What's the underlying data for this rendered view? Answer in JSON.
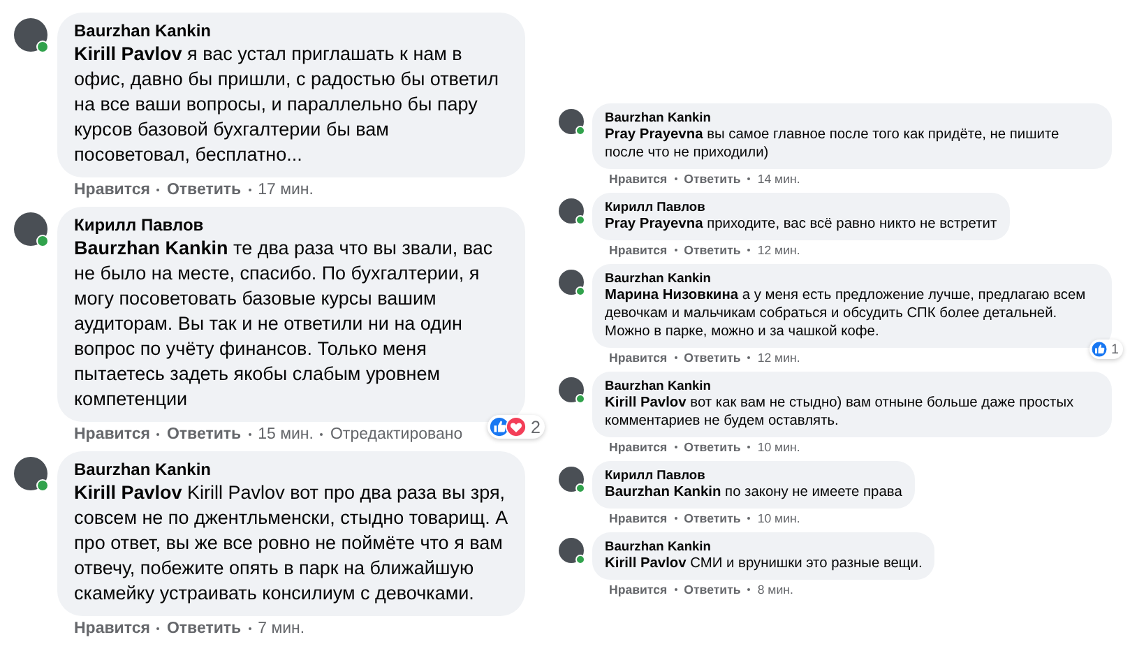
{
  "columns": [
    {
      "kind": "large",
      "comments": [
        {
          "author": "Baurzhan Kankin",
          "online": true,
          "text": "**Kirill Pavlov** я вас устал приглашать к нам в офис, давно бы пришли, с радостью бы ответил на все ваши вопросы, и параллельно бы пару курсов базовой бухгалтерии бы вам посоветовал, бесплатно...",
          "actions": [
            {
              "kind": "link",
              "text": "Нравится"
            },
            {
              "kind": "link",
              "text": "Ответить"
            },
            {
              "kind": "time",
              "text": "17 мин."
            }
          ]
        },
        {
          "author": "Кирилл Павлов",
          "online": true,
          "text": "**Baurzhan Kankin** те два раза что вы звали, вас не было на месте, спасибо. По бухгалтерии, я могу посоветовать базовые курсы вашим аудиторам. Вы так и не ответили ни на один вопрос по учёту финансов. Только меня пытаетесь задеть якобы слабым уровнем компетенции",
          "actions": [
            {
              "kind": "link",
              "text": "Нравится"
            },
            {
              "kind": "link",
              "text": "Ответить"
            },
            {
              "kind": "time",
              "text": "15 мин."
            },
            {
              "kind": "note",
              "text": "Отредактировано"
            }
          ],
          "reactions": {
            "items": [
              {
                "kind": "like"
              },
              {
                "kind": "love"
              }
            ],
            "count": "2"
          }
        },
        {
          "author": "Baurzhan Kankin",
          "online": true,
          "text": "**Kirill Pavlov** Kirill Pavlov вот про два раза вы зря, совсем не по джентльменски, стыдно товарищ. А про ответ, вы же все ровно не поймёте что я вам отвечу, побежите опять в парк на ближайшую скамейку устраивать консилиум с девочками.",
          "actions": [
            {
              "kind": "link",
              "text": "Нравится"
            },
            {
              "kind": "link",
              "text": "Ответить"
            },
            {
              "kind": "time",
              "text": "7 мин."
            }
          ]
        }
      ]
    },
    {
      "kind": "small",
      "comments": [
        {
          "author": "Baurzhan Kankin",
          "online": true,
          "text": "**Pray Prayevna** вы самое главное после того как придёте, не пишите после что не приходили)",
          "actions": [
            {
              "kind": "link",
              "text": "Нравится"
            },
            {
              "kind": "link",
              "text": "Ответить"
            },
            {
              "kind": "time",
              "text": "14 мин."
            }
          ]
        },
        {
          "author": "Кирилл Павлов",
          "online": true,
          "text": "**Pray Prayevna** приходите, вас всё равно никто не встретит",
          "actions": [
            {
              "kind": "link",
              "text": "Нравится"
            },
            {
              "kind": "link",
              "text": "Ответить"
            },
            {
              "kind": "time",
              "text": "12 мин."
            }
          ]
        },
        {
          "author": "Baurzhan Kankin",
          "online": true,
          "text": "**Марина Низовкина** а у меня есть предложение лучше, предлагаю всем девочкам и мальчикам собраться и обсудить СПК более детальней. Можно в парке, можно и за чашкой кофе.",
          "actions": [
            {
              "kind": "link",
              "text": "Нравится"
            },
            {
              "kind": "link",
              "text": "Ответить"
            },
            {
              "kind": "time",
              "text": "12 мин."
            }
          ],
          "reactions": {
            "items": [
              {
                "kind": "like"
              }
            ],
            "count": "1"
          }
        },
        {
          "author": "Baurzhan Kankin",
          "online": true,
          "text": "**Kirill Pavlov** вот как вам не стыдно) вам отныне больше даже простых комментариев не будем оставлять.",
          "actions": [
            {
              "kind": "link",
              "text": "Нравится"
            },
            {
              "kind": "link",
              "text": "Ответить"
            },
            {
              "kind": "time",
              "text": "10 мин."
            }
          ]
        },
        {
          "author": "Кирилл Павлов",
          "online": true,
          "text": "**Baurzhan Kankin** по закону не имеете права",
          "actions": [
            {
              "kind": "link",
              "text": "Нравится"
            },
            {
              "kind": "link",
              "text": "Ответить"
            },
            {
              "kind": "time",
              "text": "10 мин."
            }
          ]
        },
        {
          "author": "Baurzhan Kankin",
          "online": true,
          "text": "**Kirill Pavlov** СМИ и врунишки это разные вещи.",
          "actions": [
            {
              "kind": "link",
              "text": "Нравится"
            },
            {
              "kind": "link",
              "text": "Ответить"
            },
            {
              "kind": "time",
              "text": "8 мин."
            }
          ]
        }
      ]
    }
  ]
}
